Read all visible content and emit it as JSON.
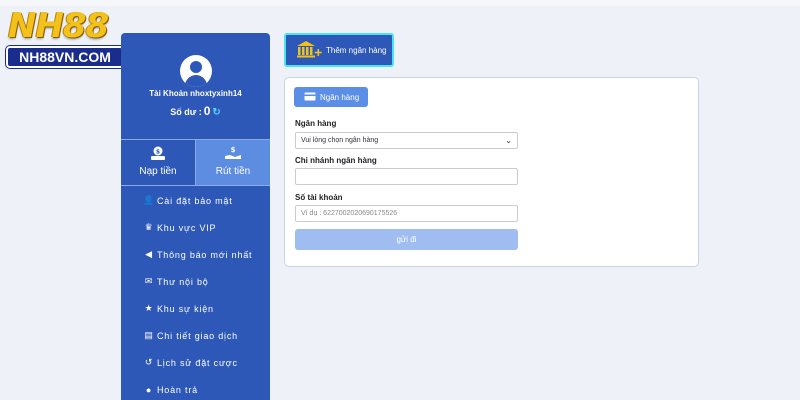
{
  "logo": {
    "word": "NH88",
    "site": "NH88VN.COM"
  },
  "user": {
    "account_label": "Tài Khoản nhoxtyxinh14",
    "balance_label": "Số dư :",
    "balance_value": "0"
  },
  "actions": {
    "deposit": "Nạp tiền",
    "withdraw": "Rút tiền"
  },
  "menu": [
    {
      "label": "Cài đặt bảo mật",
      "icon": "user-lock-icon"
    },
    {
      "label": "Khu vực VIP",
      "icon": "crown-icon"
    },
    {
      "label": "Thông báo mới nhất",
      "icon": "megaphone-icon"
    },
    {
      "label": "Thư nội bộ",
      "icon": "envelope-icon"
    },
    {
      "label": "Khu sự kiện",
      "icon": "trophy-icon"
    },
    {
      "label": "Chi tiết giao dịch",
      "icon": "clipboard-icon"
    },
    {
      "label": "Lịch sử đặt cược",
      "icon": "history-icon"
    },
    {
      "label": "Hoàn trả",
      "icon": "dollar-icon"
    }
  ],
  "add_bank_label": "Thêm ngân hàng",
  "form": {
    "tab_label": "Ngân hàng",
    "bank_label": "Ngân hàng",
    "bank_select_value": "Vui lòng chọn ngân hàng",
    "branch_label": "Chi nhánh ngân hàng",
    "branch_value": "",
    "account_number_label": "Số tài khoản",
    "account_number_placeholder": "Ví dụ : 6227002020690175526",
    "submit_label": "gửi đi"
  },
  "colors": {
    "sidebar": "#2d58b8",
    "accent_border": "#47e5f2",
    "tab": "#5b8ee6",
    "submit": "#9fbdf0",
    "logo_gold": "#f2c21b"
  }
}
